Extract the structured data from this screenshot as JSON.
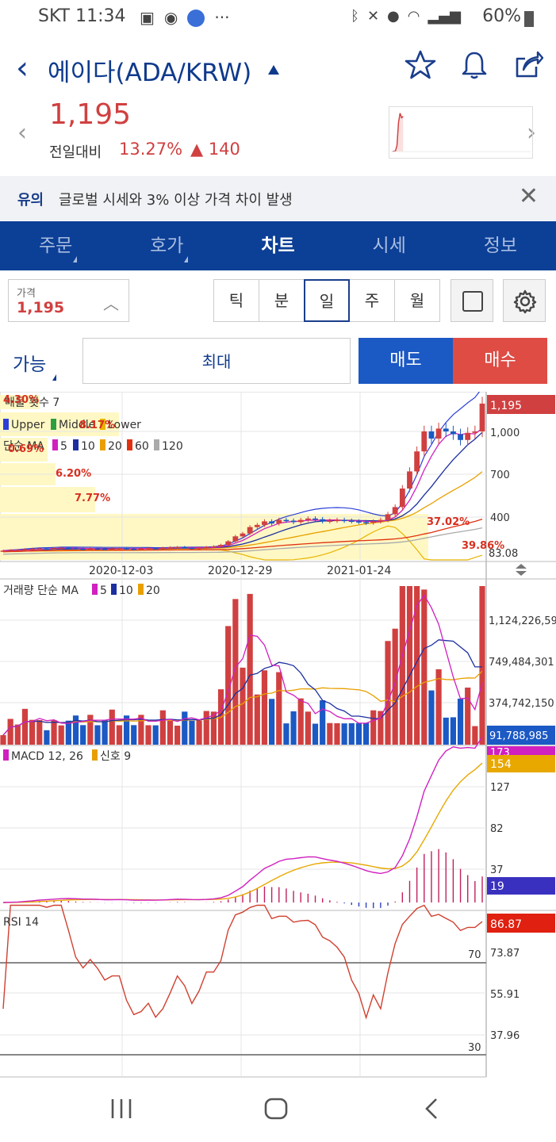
{
  "status": {
    "carrier_time": "SKT 11:34",
    "battery": "60%"
  },
  "header": {
    "title": "에이다(ADA/KRW)"
  },
  "quote": {
    "price": "1,195",
    "prev_label": "전일대비",
    "change_pct": "13.27%",
    "change_abs": "▲ 140"
  },
  "notice": {
    "label": "유의",
    "text": "글로벌 시세와 3% 이상 가격 차이 발생"
  },
  "tabs": [
    {
      "label": "주문",
      "active": false
    },
    {
      "label": "호가",
      "active": false
    },
    {
      "label": "차트",
      "active": true
    },
    {
      "label": "시세",
      "active": false
    },
    {
      "label": "정보",
      "active": false
    }
  ],
  "price_selector": {
    "label": "가격",
    "value": "1,195"
  },
  "periods": [
    "틱",
    "분",
    "일",
    "주",
    "월"
  ],
  "selected_period": "일",
  "order": {
    "available": "가능",
    "max": "최대",
    "sell": "매도",
    "buy": "매수"
  },
  "colors": {
    "brand": "#0c3f96",
    "up": "#d04040",
    "down": "#1b59c4"
  },
  "chart_data": {
    "type": "candlestick",
    "price_panel": {
      "legend_top": "매물 횟수 7",
      "bb_legend": [
        "Upper",
        "Middle",
        "Lower"
      ],
      "ma_legend": {
        "label": "단순 MA",
        "periods": [
          "5",
          "10",
          "20",
          "60",
          "120"
        ]
      },
      "y_ticks": [
        "1,195",
        "1,000",
        "700",
        "400",
        "83.08"
      ],
      "current": "1,195",
      "percent_labels": [
        "4.30%",
        "8.17%",
        "0.69%",
        "6.20%",
        "7.77%",
        "37.02%",
        "39.86%"
      ],
      "x_ticks": [
        "2020-12-03",
        "2020-12-29",
        "2021-01-24"
      ],
      "close_approx": [
        165,
        168,
        170,
        175,
        178,
        181,
        180,
        183,
        185,
        182,
        178,
        176,
        180,
        178,
        175,
        180,
        182,
        178,
        176,
        180,
        182,
        180,
        185,
        188,
        190,
        185,
        182,
        185,
        190,
        195,
        205,
        230,
        265,
        285,
        330,
        345,
        370,
        355,
        380,
        375,
        365,
        380,
        390,
        385,
        370,
        375,
        380,
        375,
        370,
        365,
        360,
        370,
        380,
        420,
        470,
        600,
        720,
        860,
        1000,
        950,
        1020,
        1000,
        980,
        940,
        990,
        1000,
        1195
      ]
    },
    "volume_panel": {
      "legend": {
        "label": "거래량 단순 MA",
        "periods": [
          "5",
          "10",
          "20"
        ]
      },
      "y_ticks": [
        "1,124,226,593",
        "749,484,301",
        "374,742,150",
        "91,788,985"
      ],
      "current": "91,788,985"
    },
    "macd_panel": {
      "legend": [
        "MACD 12, 26",
        "신호 9"
      ],
      "y_ticks": [
        "173",
        "154",
        "127",
        "82",
        "37",
        "19"
      ]
    },
    "rsi_panel": {
      "legend": "RSI 14",
      "y_ticks": [
        "86.87",
        "73.87",
        "55.91",
        "37.96"
      ],
      "levels": [
        "70",
        "30"
      ]
    }
  }
}
